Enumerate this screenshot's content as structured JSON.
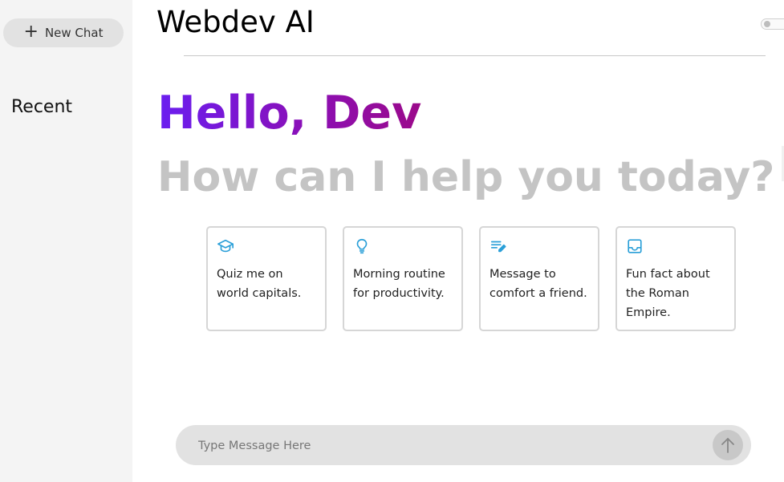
{
  "sidebar": {
    "new_chat_label": "New Chat",
    "recent_heading": "Recent"
  },
  "header": {
    "title": "Webdev AI"
  },
  "greeting": {
    "hello": "Hello, Dev",
    "subtitle": "How can I help you today?"
  },
  "cards": [
    {
      "icon": "graduation-cap-icon",
      "text": "Quiz me on world capitals."
    },
    {
      "icon": "lightbulb-icon",
      "text": "Morning routine for productivity."
    },
    {
      "icon": "edit-note-icon",
      "text": "Message to comfort a friend."
    },
    {
      "icon": "inbox-icon",
      "text": "Fun fact about the Roman Empire."
    }
  ],
  "composer": {
    "placeholder": "Type Message Here",
    "value": ""
  },
  "colors": {
    "accent_blue": "#2a9fd8",
    "gradient_start": "#6a1ef0",
    "gradient_end": "#9b0a8a",
    "subtitle_gray": "#c4c4c4"
  }
}
